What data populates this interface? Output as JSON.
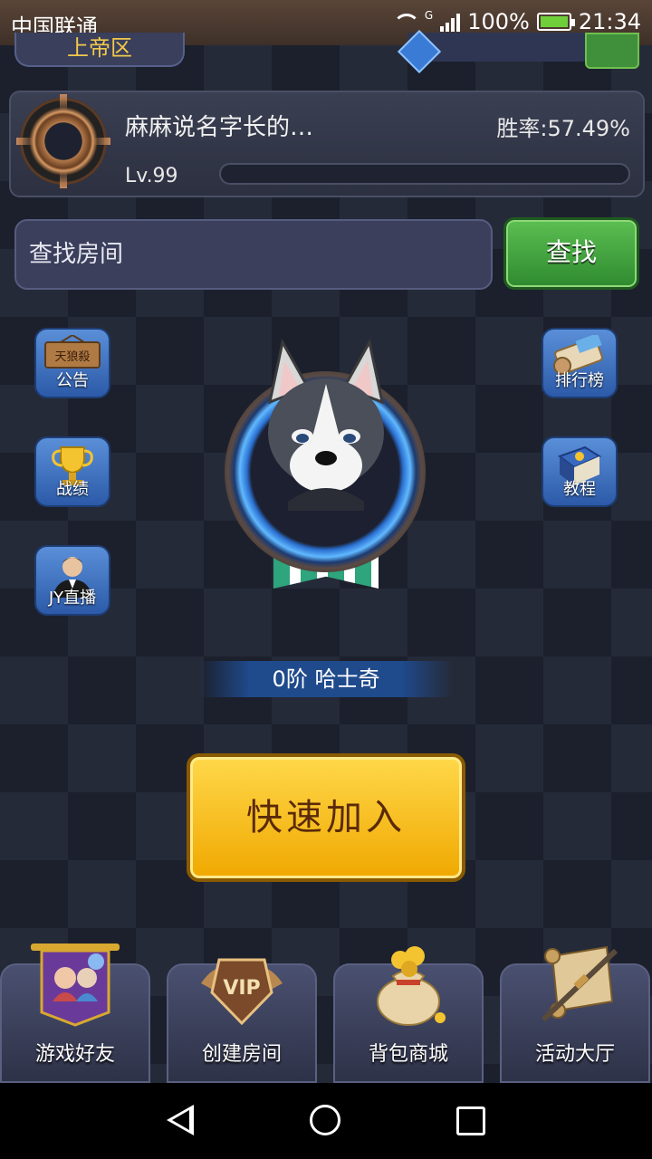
{
  "status_bar": {
    "carrier": "中国联通",
    "network": "G",
    "battery": "100%",
    "time": "21:34"
  },
  "zone": {
    "label": "上帝区"
  },
  "profile": {
    "name": "麻麻说名字长的…",
    "winrate": "胜率:57.49%",
    "level": "Lv.99"
  },
  "search": {
    "placeholder": "查找房间",
    "button": "查找"
  },
  "side_left": [
    {
      "label": "公告"
    },
    {
      "label": "战绩"
    },
    {
      "label": "JY直播"
    }
  ],
  "side_right": [
    {
      "label": "排行榜"
    },
    {
      "label": "教程"
    }
  ],
  "side_left_0_sign": "天狼殺",
  "rank": {
    "label": "0阶 哈士奇"
  },
  "quick_join": {
    "label": "快速加入"
  },
  "bottom_nav": [
    {
      "label": "游戏好友"
    },
    {
      "label": "创建房间"
    },
    {
      "label": "背包商城"
    },
    {
      "label": "活动大厅"
    }
  ],
  "colors": {
    "accent_green": "#3f9a3a",
    "accent_gold": "#f5b800",
    "panel": "#3a3f52"
  }
}
